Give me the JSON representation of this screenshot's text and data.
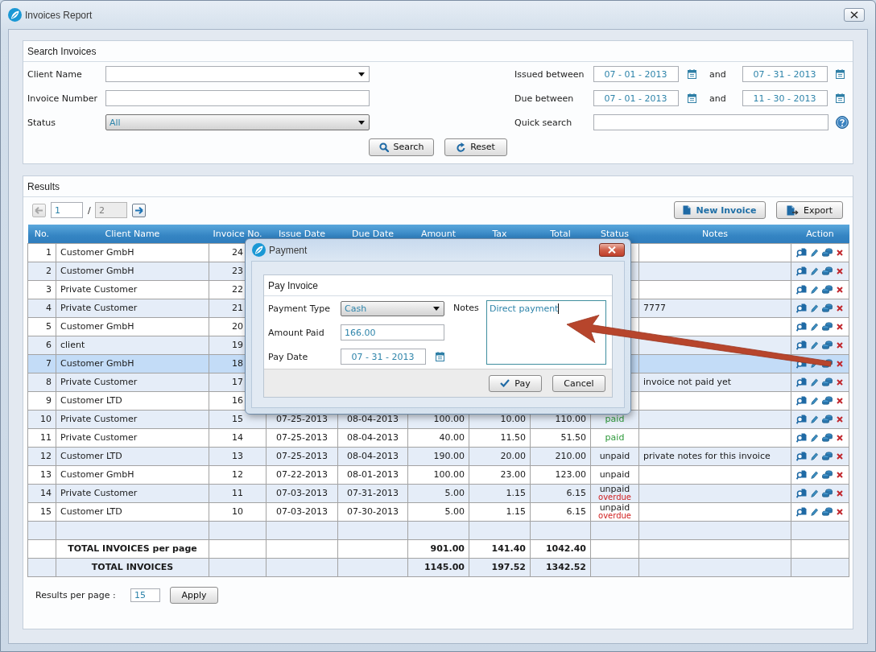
{
  "window": {
    "title": "Invoices Report"
  },
  "search": {
    "title": "Search Invoices",
    "fields": [
      {
        "label": "Client Name",
        "kind": "combo"
      },
      {
        "label": "Invoice Number",
        "kind": "text"
      },
      {
        "label": "Status",
        "kind": "select",
        "value": "All"
      }
    ],
    "ranges": [
      {
        "label": "Issued between",
        "from": "07 - 01 - 2013",
        "joiner": "and",
        "to": "07 - 31 - 2013"
      },
      {
        "label": "Due between",
        "from": "07 - 01 - 2013",
        "joiner": "and",
        "to": "11 - 30 - 2013"
      }
    ],
    "quick_search": {
      "label": "Quick search"
    },
    "buttons": [
      {
        "label": "Search",
        "kind": "search"
      },
      {
        "label": "Reset",
        "kind": "reset"
      }
    ]
  },
  "results": {
    "title": "Results",
    "pager": {
      "prev_disabled": true,
      "page": "1",
      "separator": "/",
      "pages": "2",
      "next_disabled": false
    },
    "buttons": [
      {
        "label": "New Invoice",
        "kind": "new"
      },
      {
        "label": "Export",
        "kind": "export"
      }
    ],
    "table": {
      "columns": [
        "No.",
        "Client Name",
        "Invoice No.",
        "Issue Date",
        "Due Date",
        "Amount",
        "Tax",
        "Total",
        "Status",
        "Notes",
        "Action"
      ],
      "rows": [
        {
          "no": "1",
          "client": "Customer GmbH",
          "invoice": "24",
          "selected": false
        },
        {
          "no": "2",
          "client": "Customer GmbH",
          "invoice": "23",
          "selected": false
        },
        {
          "no": "3",
          "client": "Private Customer",
          "invoice": "22",
          "selected": false
        },
        {
          "no": "4",
          "client": "Private Customer",
          "invoice": "21",
          "notes": "7777",
          "selected": false
        },
        {
          "no": "5",
          "client": "Customer GmbH",
          "invoice": "20",
          "selected": false
        },
        {
          "no": "6",
          "client": "client",
          "invoice": "19",
          "selected": false
        },
        {
          "no": "7",
          "client": "Customer GmbH",
          "invoice": "18",
          "selected": true
        },
        {
          "no": "8",
          "client": "Private Customer",
          "invoice": "17",
          "notes": "invoice not paid yet",
          "selected": false
        },
        {
          "no": "9",
          "client": "Customer LTD",
          "invoice": "16",
          "selected": false
        },
        {
          "no": "10",
          "client": "Private Customer",
          "invoice": "15",
          "issue_date": "07-25-2013",
          "due_date": "08-04-2013",
          "amount": "100.00",
          "tax": "10.00",
          "total": "110.00",
          "status": [
            {
              "text": "paid",
              "kind": "paid"
            }
          ],
          "selected": false
        },
        {
          "no": "11",
          "client": "Private Customer",
          "invoice": "14",
          "issue_date": "07-25-2013",
          "due_date": "08-04-2013",
          "amount": "40.00",
          "tax": "11.50",
          "total": "51.50",
          "status": [
            {
              "text": "paid",
              "kind": "paid"
            }
          ],
          "selected": false
        },
        {
          "no": "12",
          "client": "Customer LTD",
          "invoice": "13",
          "issue_date": "07-25-2013",
          "due_date": "08-04-2013",
          "amount": "190.00",
          "tax": "20.00",
          "total": "210.00",
          "status": [
            {
              "text": "unpaid",
              "kind": "unpaid"
            }
          ],
          "notes": "private notes for this invoice",
          "selected": false
        },
        {
          "no": "13",
          "client": "Customer GmbH",
          "invoice": "12",
          "issue_date": "07-22-2013",
          "due_date": "08-01-2013",
          "amount": "100.00",
          "tax": "23.00",
          "total": "123.00",
          "status": [
            {
              "text": "unpaid",
              "kind": "unpaid"
            }
          ],
          "selected": false
        },
        {
          "no": "14",
          "client": "Private Customer",
          "invoice": "11",
          "issue_date": "07-03-2013",
          "due_date": "07-31-2013",
          "amount": "5.00",
          "tax": "1.15",
          "total": "6.15",
          "status": [
            {
              "text": "unpaid",
              "kind": "unpaid"
            },
            {
              "text": "overdue",
              "kind": "overdue"
            }
          ],
          "selected": false
        },
        {
          "no": "15",
          "client": "Customer LTD",
          "invoice": "10",
          "issue_date": "07-03-2013",
          "due_date": "07-30-2013",
          "amount": "5.00",
          "tax": "1.15",
          "total": "6.15",
          "status": [
            {
              "text": "unpaid",
              "kind": "unpaid"
            },
            {
              "text": "overdue",
              "kind": "overdue"
            }
          ],
          "selected": false
        }
      ],
      "totals": [
        {
          "label": "TOTAL INVOICES per page",
          "amount": "901.00",
          "tax": "141.40",
          "total": "1042.40"
        },
        {
          "label": "TOTAL INVOICES",
          "amount": "1145.00",
          "tax": "197.52",
          "total": "1342.52"
        }
      ]
    },
    "per_page": {
      "label": "Results per page :",
      "value": "15",
      "button": "Apply"
    }
  },
  "dialog": {
    "title": "Payment",
    "panel_title": "Pay Invoice",
    "fields": [
      {
        "label": "Payment Type",
        "kind": "select",
        "value": "Cash"
      },
      {
        "label": "Amount Paid",
        "kind": "text",
        "value": "166.00"
      },
      {
        "label": "Pay Date",
        "kind": "date",
        "value": "07 - 31 - 2013"
      }
    ],
    "notes": {
      "label": "Notes",
      "value": "Direct payment",
      "focused": true
    },
    "buttons": [
      {
        "label": "Pay",
        "kind": "confirm"
      },
      {
        "label": "Cancel",
        "kind": "cancel"
      }
    ]
  }
}
